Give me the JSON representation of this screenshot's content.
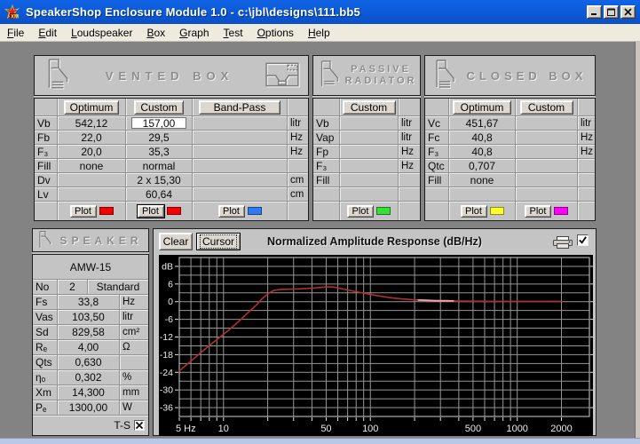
{
  "window": {
    "title": "SpeakerShop Enclosure Module 1.0 - c:\\jbl\\designs\\111.bb5"
  },
  "menu": {
    "items": [
      {
        "label": "File"
      },
      {
        "label": "Edit"
      },
      {
        "label": "Loudspeaker"
      },
      {
        "label": "Box"
      },
      {
        "label": "Graph"
      },
      {
        "label": "Test"
      },
      {
        "label": "Options"
      },
      {
        "label": "Help"
      }
    ]
  },
  "vented_box": {
    "title": "VENTED BOX",
    "buttons": [
      "Optimum",
      "Custom",
      "Band-Pass"
    ],
    "rows": [
      {
        "label": "Vb",
        "cells": [
          "542,12",
          "157,00",
          ""
        ],
        "unit": "litr",
        "white": 1
      },
      {
        "label": "Fb",
        "cells": [
          "22,0",
          "29,5",
          ""
        ],
        "unit": "Hz"
      },
      {
        "label": "F₃",
        "cells": [
          "20,0",
          "35,3",
          ""
        ],
        "unit": "Hz"
      },
      {
        "label": "Fill",
        "cells": [
          "none",
          "normal",
          ""
        ],
        "unit": ""
      },
      {
        "label": "Dv",
        "cells": [
          "",
          "2 x 15,30",
          ""
        ],
        "unit": "cm"
      },
      {
        "label": "Lv",
        "cells": [
          "",
          "60,64",
          ""
        ],
        "unit": "cm"
      }
    ],
    "plot_buttons": [
      {
        "label": "Plot",
        "column": 0,
        "chip": "#f40000"
      },
      {
        "label": "Plot",
        "column": 1,
        "chip": "#f40000",
        "focused": true
      },
      {
        "label": "Plot",
        "column": 2,
        "chip": "#2f7bf0"
      }
    ]
  },
  "passive_radiator": {
    "title": "PASSIVE RADIATOR",
    "buttons": [
      "Custom"
    ],
    "rows": [
      {
        "label": "Vb",
        "cells": [
          ""
        ],
        "unit": "litr"
      },
      {
        "label": "Vap",
        "cells": [
          ""
        ],
        "unit": "litr"
      },
      {
        "label": "Fp",
        "cells": [
          ""
        ],
        "unit": "Hz"
      },
      {
        "label": "F₃",
        "cells": [
          ""
        ],
        "unit": "Hz"
      },
      {
        "label": "Fill",
        "cells": [
          ""
        ],
        "unit": ""
      },
      {
        "label": "",
        "cells": [
          ""
        ],
        "unit": ""
      }
    ],
    "plot_buttons": [
      {
        "label": "Plot",
        "column": 0,
        "chip": "#3ade3a"
      }
    ]
  },
  "closed_box": {
    "title": "CLOSED BOX",
    "buttons": [
      "Optimum",
      "Custom"
    ],
    "rows": [
      {
        "label": "Vc",
        "cells": [
          "451,67",
          ""
        ],
        "unit": "litr"
      },
      {
        "label": "Fc",
        "cells": [
          "40,8",
          ""
        ],
        "unit": "Hz"
      },
      {
        "label": "F₃",
        "cells": [
          "40,8",
          ""
        ],
        "unit": "Hz"
      },
      {
        "label": "Qtc",
        "cells": [
          "0,707",
          ""
        ],
        "unit": ""
      },
      {
        "label": "Fill",
        "cells": [
          "none",
          ""
        ],
        "unit": ""
      },
      {
        "label": "",
        "cells": [
          "",
          ""
        ],
        "unit": ""
      }
    ],
    "plot_buttons": [
      {
        "label": "Plot",
        "column": 0,
        "chip": "#ffff2e"
      },
      {
        "label": "Plot",
        "column": 1,
        "chip": "#ff00ff"
      }
    ]
  },
  "speaker": {
    "title": "SPEAKER",
    "model": "AMW-15",
    "no_row": {
      "label": "No",
      "value": "2",
      "type": "Standard"
    },
    "rows": [
      {
        "label": "Fs",
        "value": "33,8",
        "unit": "Hz"
      },
      {
        "label": "Vas",
        "value": "103,50",
        "unit": "litr"
      },
      {
        "label": "Sd",
        "value": "829,58",
        "unit": "cm²"
      },
      {
        "label": "Rₑ",
        "value": "4,00",
        "unit": "Ω"
      },
      {
        "label": "Qts",
        "value": "0,630",
        "unit": ""
      },
      {
        "label": "ηₒ",
        "value": "0,302",
        "unit": "%"
      },
      {
        "label": "Xm",
        "value": "14,300",
        "unit": "mm"
      },
      {
        "label": "Pₑ",
        "value": "1300,00",
        "unit": "W"
      }
    ],
    "ts_label": "T-S",
    "ts_checked": true
  },
  "chart": {
    "clear_label": "Clear",
    "cursor_label": "Cursor",
    "title": "Normalized Amplitude Response (dB/Hz)",
    "print_icon": "printer-icon",
    "enabled_checkbox": true
  },
  "chart_data": {
    "type": "line",
    "title": "Normalized Amplitude Response (dB/Hz)",
    "x_scale": "log",
    "xlim": [
      5,
      3100
    ],
    "ylim": [
      -39,
      15
    ],
    "xlabel": "Hz",
    "ylabel": "dB",
    "grid": true,
    "background": "#000000",
    "grid_color": "#969696",
    "x_gridlines": [
      5,
      6,
      7,
      8,
      9,
      10,
      20,
      30,
      40,
      50,
      60,
      70,
      80,
      90,
      100,
      200,
      300,
      400,
      500,
      600,
      700,
      800,
      900,
      1000,
      2000
    ],
    "x_tick_labels": [
      {
        "value": 5,
        "label": "5 Hz"
      },
      {
        "value": 10,
        "label": "10"
      },
      {
        "value": 50,
        "label": "50"
      },
      {
        "value": 100,
        "label": "100"
      },
      {
        "value": 500,
        "label": "500"
      },
      {
        "value": 1000,
        "label": "1000"
      },
      {
        "value": 2000,
        "label": "2000"
      }
    ],
    "y_gridline_step": 3,
    "y_tick_labels": [
      {
        "value": 12,
        "label": "dB"
      },
      {
        "value": 6,
        "label": "6"
      },
      {
        "value": 0,
        "label": "0"
      },
      {
        "value": -6,
        "label": "-6"
      },
      {
        "value": -12,
        "label": "-12"
      },
      {
        "value": -18,
        "label": "-18"
      },
      {
        "value": -24,
        "label": "-24"
      },
      {
        "value": -30,
        "label": "-30"
      },
      {
        "value": -36,
        "label": "-36"
      }
    ],
    "series": [
      {
        "name": "vented-custom-response",
        "color": "#b23030",
        "width": 1.6,
        "points": [
          [
            5,
            -23.5
          ],
          [
            5.5,
            -21.8
          ],
          [
            6,
            -20.2
          ],
          [
            7,
            -17.3
          ],
          [
            8,
            -14.9
          ],
          [
            9,
            -12.9
          ],
          [
            10,
            -11.1
          ],
          [
            11,
            -9.4
          ],
          [
            12,
            -7.8
          ],
          [
            13,
            -6.2
          ],
          [
            14,
            -4.7
          ],
          [
            15,
            -3.3
          ],
          [
            16,
            -2.0
          ],
          [
            17,
            -0.8
          ],
          [
            18,
            0.6
          ],
          [
            19,
            1.7
          ],
          [
            20,
            2.6
          ],
          [
            21,
            3.3
          ],
          [
            22,
            3.8
          ],
          [
            24,
            4.1
          ],
          [
            26,
            4.2
          ],
          [
            30,
            4.3
          ],
          [
            35,
            4.4
          ],
          [
            40,
            4.6
          ],
          [
            45,
            4.8
          ],
          [
            50,
            5.0
          ],
          [
            55,
            5.0
          ],
          [
            60,
            4.7
          ],
          [
            65,
            4.3
          ],
          [
            70,
            4.0
          ],
          [
            80,
            3.4
          ],
          [
            90,
            2.9
          ],
          [
            100,
            2.5
          ],
          [
            110,
            2.1
          ],
          [
            120,
            1.8
          ],
          [
            140,
            1.3
          ],
          [
            160,
            1.0
          ],
          [
            200,
            0.6
          ],
          [
            250,
            0.4
          ],
          [
            300,
            0.3
          ],
          [
            400,
            0.2
          ],
          [
            500,
            0.15
          ],
          [
            700,
            0.1
          ],
          [
            1000,
            0.1
          ],
          [
            1500,
            0.1
          ],
          [
            2000,
            0.1
          ]
        ]
      },
      {
        "name": "overlap-highlight",
        "color": "#ff9e9e",
        "width": 1.8,
        "points": [
          [
            210,
            0.55
          ],
          [
            240,
            0.45
          ],
          [
            280,
            0.35
          ],
          [
            330,
            0.3
          ],
          [
            370,
            0.25
          ]
        ]
      }
    ]
  },
  "colors": {
    "titlebar_blue": "#0b59d7",
    "panel_silver": "#c4c4c4",
    "plot_background": "#000000",
    "curve_red": "#b23030",
    "desktop_strip": "#b9c8e6"
  }
}
